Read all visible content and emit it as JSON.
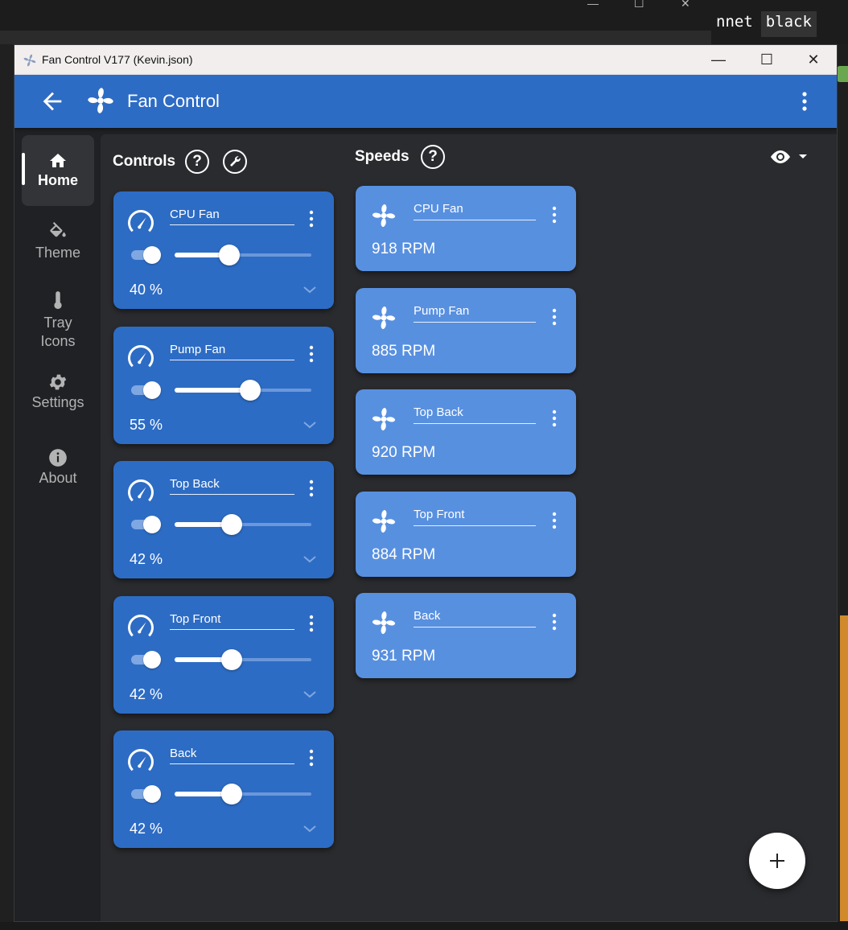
{
  "background": {
    "tab_partial": "nnet",
    "tab_word": "black"
  },
  "window": {
    "title": "Fan Control V177 (Kevin.json)",
    "minimize_glyph": "—",
    "maximize_glyph": "☐",
    "close_glyph": "✕"
  },
  "appbar": {
    "title": "Fan Control",
    "back_icon": "arrow-left-icon",
    "logo_icon": "fan-icon",
    "menu_icon": "more-vertical-icon",
    "color": "#2d6cc4"
  },
  "sidebar": {
    "items": [
      {
        "label": "Home",
        "icon": "home-icon",
        "active": true
      },
      {
        "label": "Theme",
        "icon": "paint-bucket-icon",
        "active": false
      },
      {
        "label": "Tray Icons",
        "icon": "thermometer-icon",
        "active": false
      },
      {
        "label": "Settings",
        "icon": "gear-icon",
        "active": false
      },
      {
        "label": "About",
        "icon": "info-icon",
        "active": false
      }
    ]
  },
  "controls": {
    "heading": "Controls",
    "help_glyph": "?",
    "cards": [
      {
        "name": "CPU Fan",
        "value": 40,
        "percent_label": "40 %"
      },
      {
        "name": "Pump Fan",
        "value": 55,
        "percent_label": "55 %"
      },
      {
        "name": "Top Back",
        "value": 42,
        "percent_label": "42 %"
      },
      {
        "name": "Top Front",
        "value": 42,
        "percent_label": "42 %"
      },
      {
        "name": "Back",
        "value": 42,
        "percent_label": "42 %"
      }
    ]
  },
  "speeds": {
    "heading": "Speeds",
    "help_glyph": "?",
    "cards": [
      {
        "name": "CPU Fan",
        "rpm_label": "918 RPM"
      },
      {
        "name": "Pump Fan",
        "rpm_label": "885 RPM"
      },
      {
        "name": "Top Back",
        "rpm_label": "920 RPM"
      },
      {
        "name": "Top Front",
        "rpm_label": "884 RPM"
      },
      {
        "name": "Back",
        "rpm_label": "931 RPM"
      }
    ],
    "card_color": "#5890e0"
  },
  "fab": {
    "icon": "plus-icon"
  }
}
